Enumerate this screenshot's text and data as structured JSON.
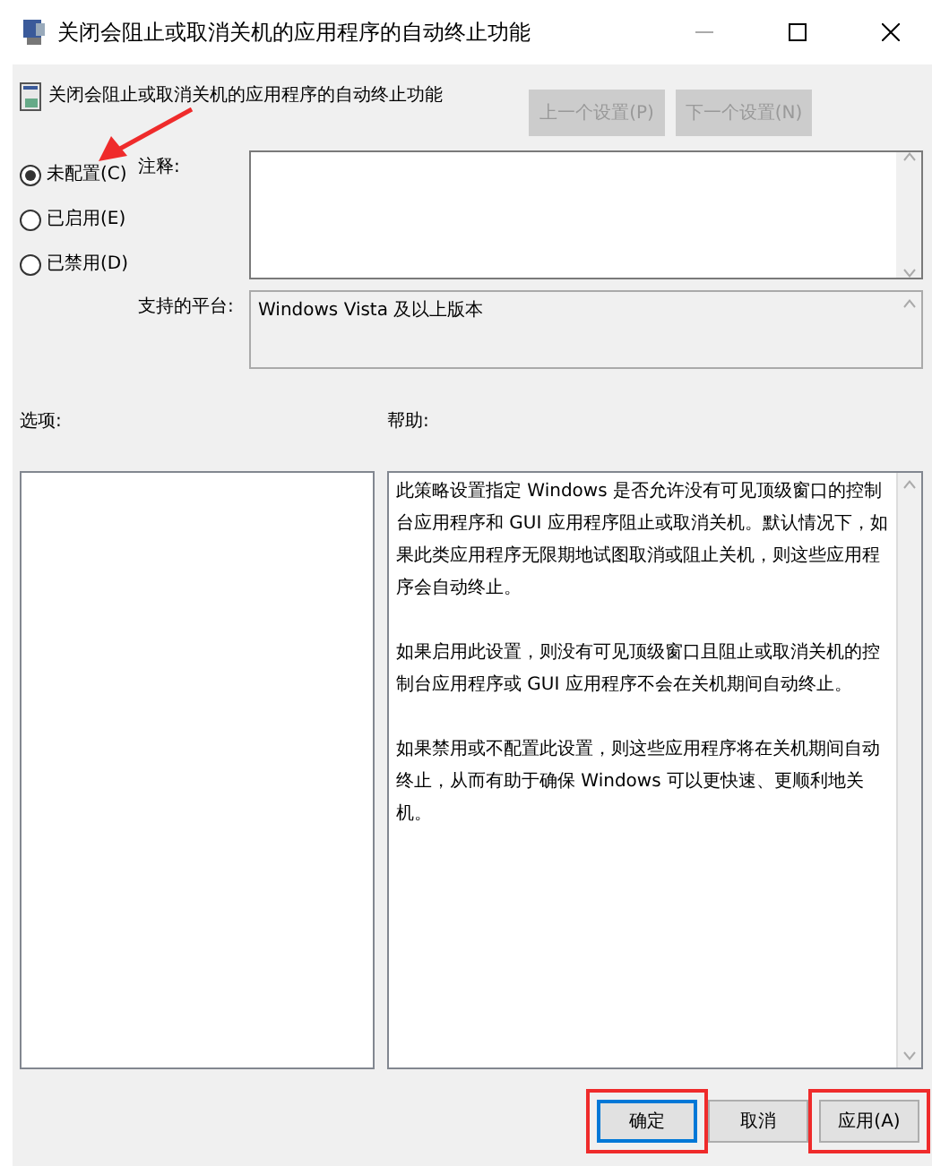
{
  "window": {
    "title": "关闭会阻止或取消关机的应用程序的自动终止功能"
  },
  "header": {
    "title": "关闭会阻止或取消关机的应用程序的自动终止功能"
  },
  "nav_buttons": [
    {
      "label": "上一个设置(P)",
      "disabled": true
    },
    {
      "label": "下一个设置(N)",
      "disabled": true
    }
  ],
  "options": [
    {
      "label": "未配置(C)",
      "selected": true
    },
    {
      "label": "已启用(E)",
      "selected": false
    },
    {
      "label": "已禁用(D)",
      "selected": false
    }
  ],
  "comment": {
    "label": "注释:"
  },
  "platform": {
    "label": "支持的平台:",
    "value": "Windows Vista 及以上版本"
  },
  "options_label": "选项:",
  "help_label": "帮助:",
  "help_text": [
    "此策略设置指定 Windows 是否允许没有可见顶级窗口的控制台应用程序和 GUI 应用程序阻止或取消关机。默认情况下，如果此类应用程序无限期地试图取消或阻止关机，则这些应用程序会自动终止。",
    "如果启用此设置，则没有可见顶级窗口且阻止或取消关机的控制台应用程序或 GUI 应用程序不会在关机期间自动终止。",
    "如果禁用或不配置此设置，则这些应用程序将在关机期间自动终止，从而有助于确保 Windows 可以更快速、更顺利地关机。"
  ],
  "buttons": [
    {
      "label": "确定",
      "default": true,
      "highlighted": true
    },
    {
      "label": "取消",
      "default": false,
      "highlighted": false
    },
    {
      "label": "应用(A)",
      "default": false,
      "highlighted": true
    }
  ]
}
